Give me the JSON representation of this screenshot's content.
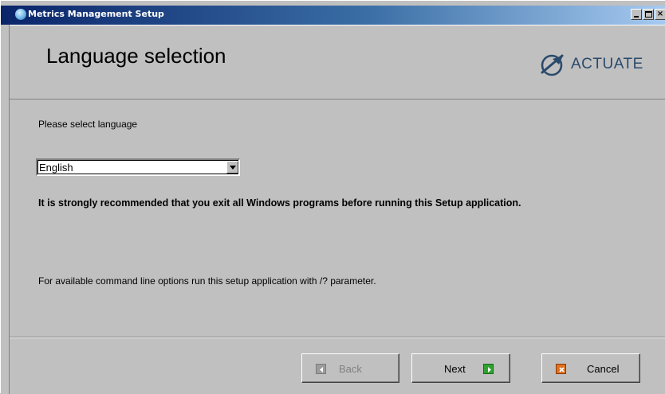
{
  "window": {
    "title": "Metrics Management Setup",
    "caption_buttons": {
      "minimize": "minimize",
      "maximize": "maximize",
      "close": "×"
    }
  },
  "header": {
    "title": "Language selection",
    "logo_text": "ACTUATE"
  },
  "main": {
    "prompt": "Please select language",
    "language_select": {
      "value": "English"
    },
    "warning": "It is strongly recommended that you exit all Windows programs before running this Setup application.",
    "cmdline_note": "For available command line options run this setup application with /? parameter."
  },
  "footer": {
    "back_label": "Back",
    "next_label": "Next",
    "cancel_label": "Cancel"
  },
  "icons": {
    "app": "setup-app-icon",
    "logo": "actuate-logo-icon",
    "back": "back-arrow-icon",
    "next": "next-arrow-icon",
    "cancel": "cancel-x-icon",
    "dropdown": "chevron-down-icon"
  },
  "colors": {
    "titlebar_start": "#0a246a",
    "titlebar_end": "#a6caf0",
    "window_bg": "#c0c0c0",
    "next_icon": "#2fa32f",
    "cancel_icon": "#e07020",
    "logo": "#2a4a6c"
  }
}
